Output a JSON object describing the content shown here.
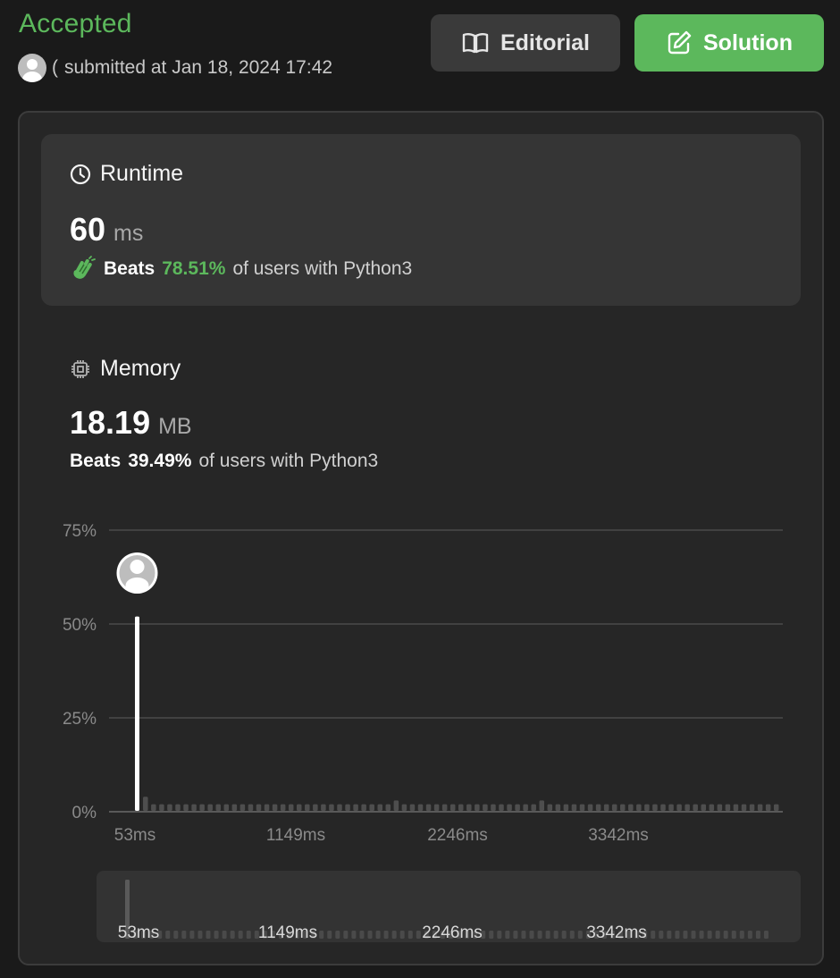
{
  "header": {
    "status": "Accepted",
    "user_initial": "(",
    "submitted_text": "submitted at Jan 18, 2024 17:42"
  },
  "buttons": {
    "editorial": "Editorial",
    "solution": "Solution"
  },
  "runtime": {
    "heading": "Runtime",
    "value": "60",
    "unit": "ms",
    "beats_label": "Beats",
    "beats_pct": "78.51%",
    "beats_suffix": "of users with Python3"
  },
  "memory": {
    "heading": "Memory",
    "value": "18.19",
    "unit": "MB",
    "beats_label": "Beats",
    "beats_pct": "39.49%",
    "beats_suffix": "of users with Python3"
  },
  "colors": {
    "accent_green": "#5cb85c",
    "background": "#1a1a1a",
    "panel": "#262626",
    "card": "#353535"
  },
  "chart_data": {
    "type": "bar",
    "yticks": [
      "75%",
      "50%",
      "25%",
      "0%"
    ],
    "ylim": [
      0,
      75
    ],
    "xticks": [
      "53ms",
      "1149ms",
      "2246ms",
      "3342ms"
    ],
    "values": [
      52,
      4,
      2,
      2,
      2,
      2,
      2,
      2,
      2,
      2,
      2,
      2,
      2,
      2,
      2,
      2,
      2,
      2,
      2,
      2,
      2,
      2,
      2,
      2,
      2,
      2,
      2,
      2,
      2,
      2,
      2,
      2,
      3,
      2,
      2,
      2,
      2,
      2,
      2,
      2,
      2,
      2,
      2,
      2,
      2,
      2,
      2,
      2,
      2,
      2,
      3,
      2,
      2,
      2,
      2,
      2,
      2,
      2,
      2,
      2,
      2,
      2,
      2,
      2,
      2,
      2,
      2,
      2,
      2,
      2,
      2,
      2,
      2,
      2,
      2,
      2,
      2,
      2,
      2,
      2
    ],
    "highlight_index": 0,
    "grid": true,
    "mini_xticks": [
      "53ms",
      "1149ms",
      "2246ms",
      "3342ms"
    ]
  }
}
